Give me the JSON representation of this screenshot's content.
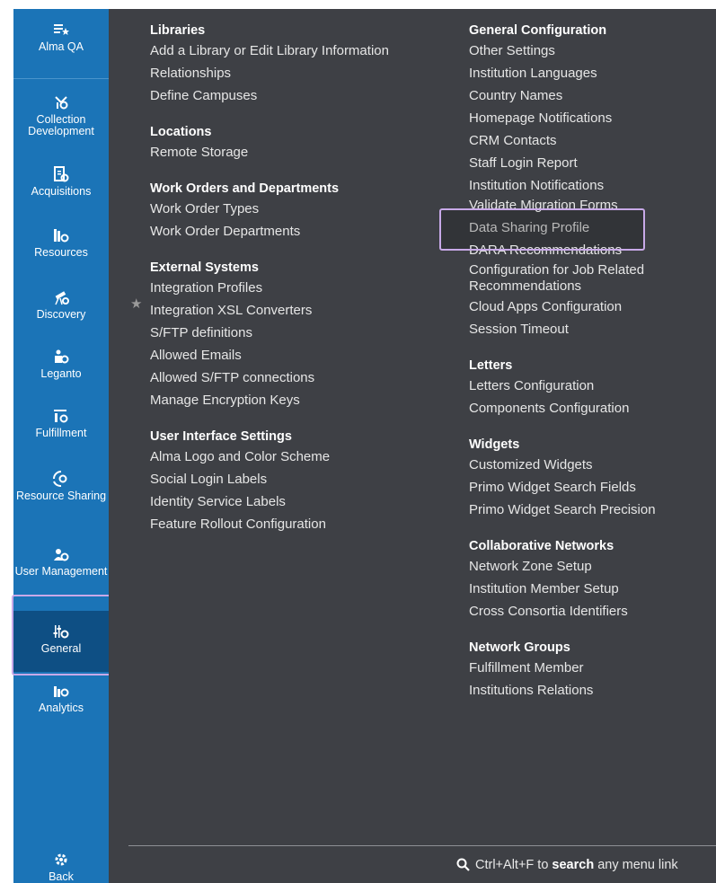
{
  "sidebar": {
    "items": [
      {
        "key": "alma-qa",
        "label": "Alma QA",
        "icon": "star-list-icon"
      },
      {
        "key": "collection-development",
        "label": "Collection Development",
        "icon": "collection-icon"
      },
      {
        "key": "acquisitions",
        "label": "Acquisitions",
        "icon": "acquisitions-icon"
      },
      {
        "key": "resources",
        "label": "Resources",
        "icon": "resources-icon"
      },
      {
        "key": "discovery",
        "label": "Discovery",
        "icon": "telescope-icon"
      },
      {
        "key": "leganto",
        "label": "Leganto",
        "icon": "leganto-icon"
      },
      {
        "key": "fulfillment",
        "label": "Fulfillment",
        "icon": "fulfillment-icon"
      },
      {
        "key": "resource-sharing",
        "label": "Resource Sharing",
        "icon": "resource-sharing-icon"
      },
      {
        "key": "user-management",
        "label": "User Management",
        "icon": "user-gear-icon"
      },
      {
        "key": "general",
        "label": "General",
        "icon": "sliders-gear-icon",
        "selected": true
      },
      {
        "key": "analytics",
        "label": "Analytics",
        "icon": "analytics-icon"
      },
      {
        "key": "back",
        "label": "Back",
        "icon": "gear-back-icon"
      }
    ]
  },
  "left_column": {
    "sections": [
      {
        "title": "Libraries",
        "links": [
          "Add a Library or Edit Library Information",
          "Relationships",
          "Define Campuses"
        ]
      },
      {
        "title": "Locations",
        "links": [
          "Remote Storage"
        ]
      },
      {
        "title": "Work Orders and Departments",
        "links": [
          "Work Order Types",
          "Work Order Departments"
        ]
      },
      {
        "title": "External Systems",
        "links": [
          "Integration Profiles",
          "Integration XSL Converters",
          "S/FTP definitions",
          "Allowed Emails",
          "Allowed S/FTP connections",
          "Manage Encryption Keys"
        ]
      },
      {
        "title": "User Interface Settings",
        "links": [
          "Alma Logo and Color Scheme",
          "Social Login Labels",
          "Identity Service Labels",
          "Feature Rollout Configuration"
        ]
      }
    ]
  },
  "right_column": {
    "sections": [
      {
        "title": "General Configuration",
        "links": [
          "Other Settings",
          "Institution Languages",
          "Country Names",
          "Homepage Notifications",
          "CRM Contacts",
          "Staff Login Report",
          "Institution Notifications",
          "Validate Migration Forms",
          "Data Sharing Profile",
          "DARA Recommendations",
          "Configuration for Job Related Recommendations",
          "Cloud Apps Configuration",
          "Session Timeout"
        ]
      },
      {
        "title": "Letters",
        "links": [
          "Letters Configuration",
          "Components Configuration"
        ]
      },
      {
        "title": "Widgets",
        "links": [
          "Customized Widgets",
          "Primo Widget Search Fields",
          "Primo Widget Search Precision"
        ]
      },
      {
        "title": "Collaborative Networks",
        "links": [
          "Network Zone Setup",
          "Institution Member Setup",
          "Cross Consortia Identifiers"
        ]
      },
      {
        "title": "Network Groups",
        "links": [
          "Fulfillment Member",
          "Institutions Relations"
        ]
      }
    ]
  },
  "footer": {
    "prefix": "Ctrl+Alt+F to ",
    "bold": "search",
    "suffix": " any menu link"
  },
  "colors": {
    "sidebar": "#1b74b7",
    "panel": "#3e4045",
    "highlight": "#c8a9e8"
  }
}
